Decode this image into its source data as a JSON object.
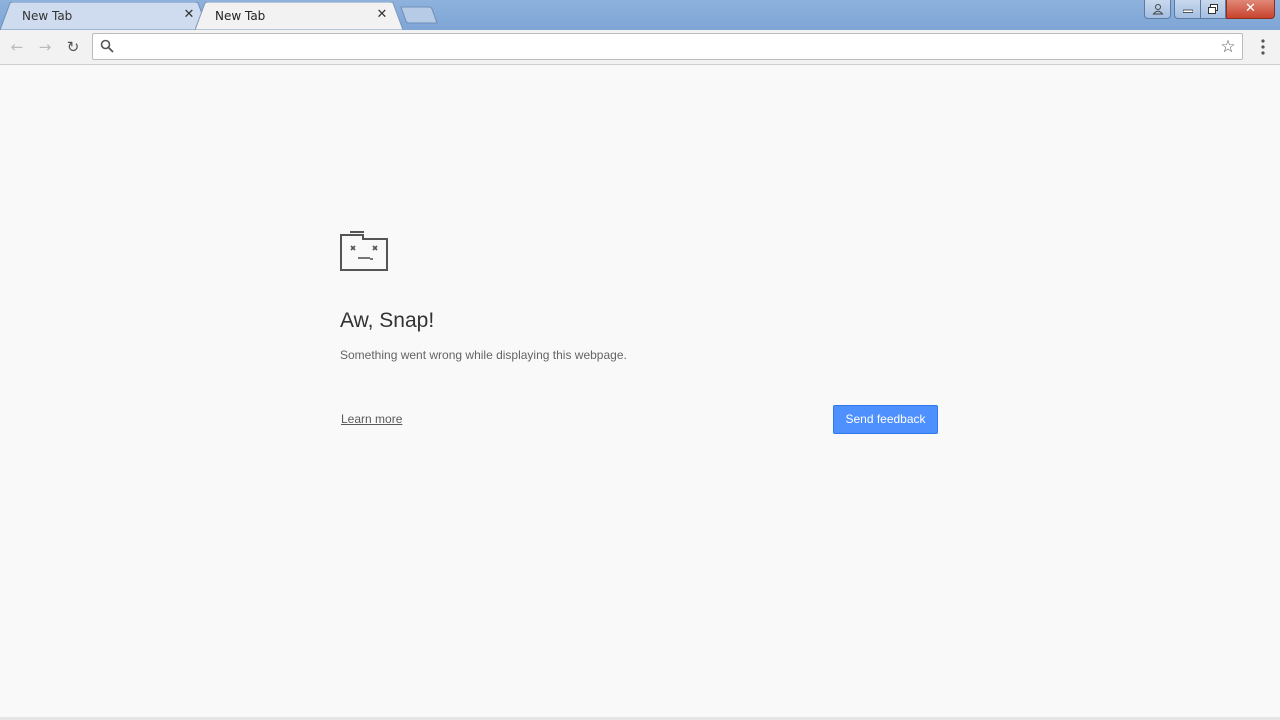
{
  "tabs": [
    {
      "title": "New Tab",
      "active": false
    },
    {
      "title": "New Tab",
      "active": true
    }
  ],
  "tab_close_glyph": "✕",
  "window_controls": {
    "profile_icon": "profile-icon",
    "minimize_icon": "minimize-icon",
    "maximize_icon": "restore-icon",
    "close_glyph": "✕"
  },
  "toolbar": {
    "back_glyph": "←",
    "forward_glyph": "→",
    "reload_glyph": "↻",
    "omnibox_value": "",
    "star_glyph": "☆"
  },
  "error": {
    "title": "Aw, Snap!",
    "message": "Something went wrong while displaying this webpage.",
    "learn_more": "Learn more",
    "feedback_button": "Send feedback"
  },
  "colors": {
    "tabstrip": "#7ea5d6",
    "button_blue": "#4d90fe",
    "page_background": "#f9f9f9",
    "close_red": "#c7432d"
  }
}
